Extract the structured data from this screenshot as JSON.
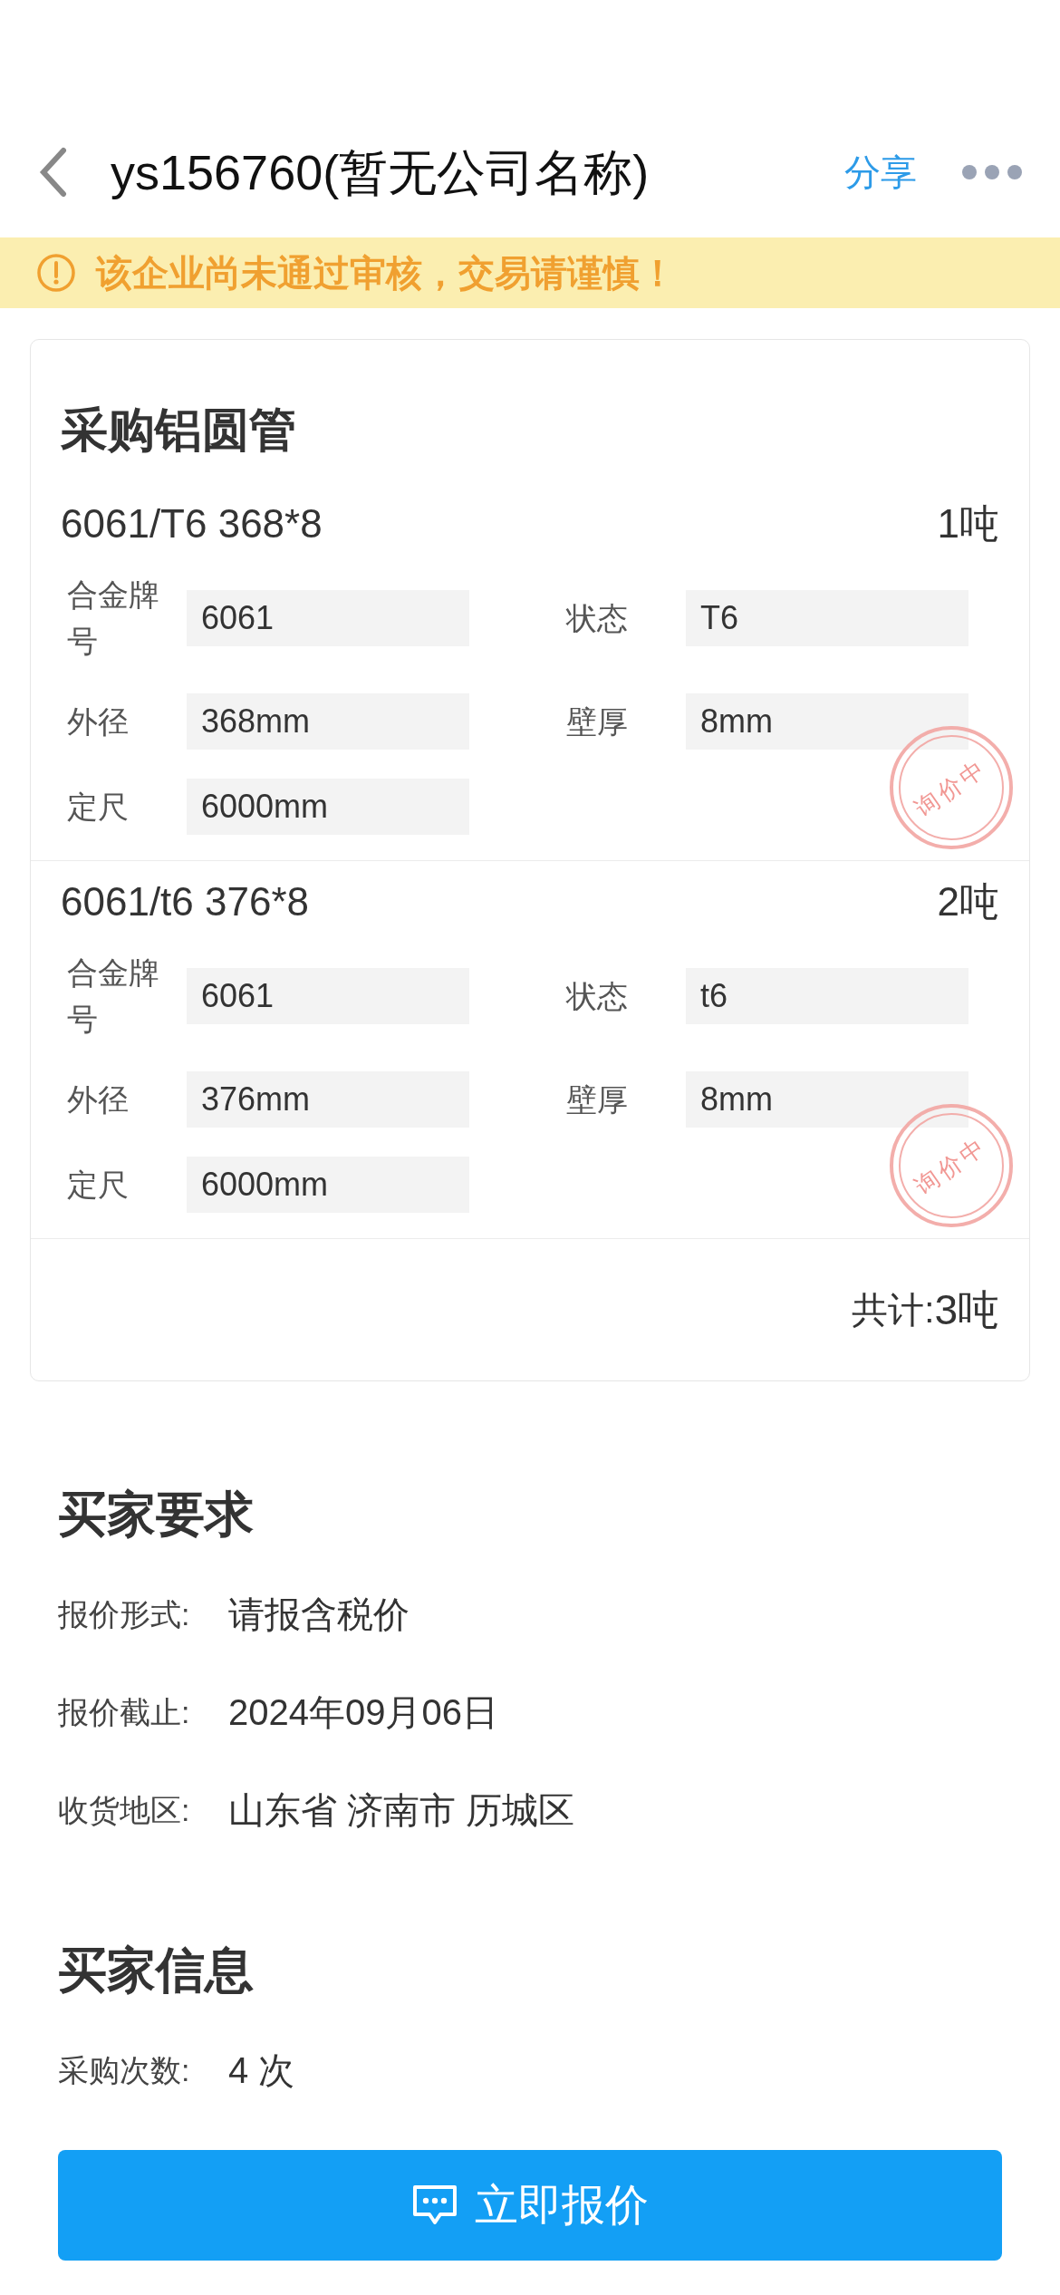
{
  "header": {
    "title": "ys156760(暂无公司名称)",
    "share": "分享"
  },
  "warning": "该企业尚未通过审核，交易请谨慎！",
  "order": {
    "title": "采购铝圆管",
    "items": [
      {
        "name": "6061/T6 368*8",
        "quantity": "1吨",
        "stamp": "询价中",
        "fields": [
          {
            "label": "合金牌号",
            "value": "6061"
          },
          {
            "label": "状态",
            "value": "T6"
          },
          {
            "label": "外径",
            "value": "368mm"
          },
          {
            "label": "壁厚",
            "value": "8mm"
          },
          {
            "label": "定尺",
            "value": "6000mm"
          }
        ]
      },
      {
        "name": "6061/t6 376*8",
        "quantity": "2吨",
        "stamp": "询价中",
        "fields": [
          {
            "label": "合金牌号",
            "value": "6061"
          },
          {
            "label": "状态",
            "value": "t6"
          },
          {
            "label": "外径",
            "value": "376mm"
          },
          {
            "label": "壁厚",
            "value": "8mm"
          },
          {
            "label": "定尺",
            "value": "6000mm"
          }
        ]
      }
    ],
    "total_label": "共计:",
    "total_value": "3吨"
  },
  "requirements": {
    "title": "买家要求",
    "rows": [
      {
        "label": "报价形式:",
        "value": "请报含税价"
      },
      {
        "label": "报价截止:",
        "value": "2024年09月06日"
      },
      {
        "label": "收货地区:",
        "value": "山东省 济南市 历城区"
      }
    ]
  },
  "buyer": {
    "title": "买家信息",
    "rows": [
      {
        "label": "采购次数:",
        "value": "4 次"
      }
    ]
  },
  "quote_button": "立即报价"
}
